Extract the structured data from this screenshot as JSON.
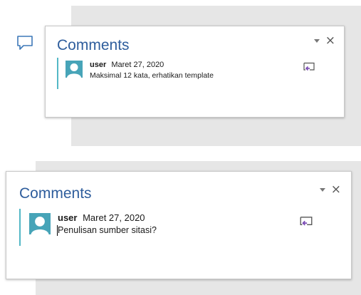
{
  "colors": {
    "accent_blue": "#2e5d9c",
    "teal_bar": "#53b8c6",
    "avatar_bg": "#47a4b8",
    "doc_gray": "#e6e6e6",
    "reply_purple": "#7a4bb5"
  },
  "icons": {
    "side_comment": "speech-bubble-icon",
    "reply": "reply-comment-icon",
    "avatar": "user-avatar-icon",
    "options": "caret-down-icon",
    "close": "close-icon"
  },
  "panes": [
    {
      "title": "Comments",
      "options_glyph": "",
      "close_glyph": "×",
      "comment": {
        "author": "user",
        "date": "Maret 27, 2020",
        "text": "Maksimal 12 kata, erhatikan template"
      }
    },
    {
      "title": "Comments",
      "options_glyph": "",
      "close_glyph": "×",
      "comment": {
        "author": "user",
        "date": "Maret 27, 2020",
        "text": "Penulisan sumber sitasi?"
      }
    }
  ]
}
